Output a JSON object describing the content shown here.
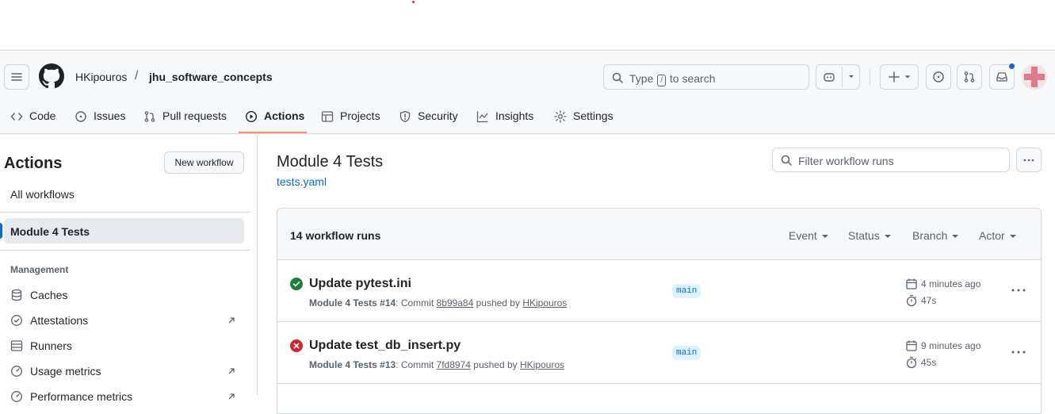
{
  "header": {
    "owner": "HKipouros",
    "separator": "/",
    "repo": "jhu_software_concepts",
    "search_prefix": "Type",
    "search_key": "/",
    "search_suffix": "to search"
  },
  "tabs": [
    {
      "label": "Code",
      "icon": "code-icon"
    },
    {
      "label": "Issues",
      "icon": "issue-icon"
    },
    {
      "label": "Pull requests",
      "icon": "pull-request-icon"
    },
    {
      "label": "Actions",
      "icon": "play-icon",
      "selected": true
    },
    {
      "label": "Projects",
      "icon": "table-icon"
    },
    {
      "label": "Security",
      "icon": "shield-icon"
    },
    {
      "label": "Insights",
      "icon": "graph-icon"
    },
    {
      "label": "Settings",
      "icon": "gear-icon"
    }
  ],
  "sidebar": {
    "title": "Actions",
    "new_workflow": "New workflow",
    "all_workflows": "All workflows",
    "active_workflow": "Module 4 Tests",
    "management_heading": "Management",
    "items": [
      {
        "label": "Caches",
        "icon": "database-icon",
        "external": false
      },
      {
        "label": "Attestations",
        "icon": "verified-icon",
        "external": true
      },
      {
        "label": "Runners",
        "icon": "server-icon",
        "external": false
      },
      {
        "label": "Usage metrics",
        "icon": "meter-icon",
        "external": true
      },
      {
        "label": "Performance metrics",
        "icon": "meter-icon",
        "external": true
      }
    ]
  },
  "main": {
    "title": "Module 4 Tests",
    "file": "tests.yaml",
    "filter_placeholder": "Filter workflow runs",
    "runs_count": "14 workflow runs",
    "filters": [
      "Event",
      "Status",
      "Branch",
      "Actor"
    ],
    "runs": [
      {
        "status": "success",
        "title": "Update pytest.ini",
        "workflow": "Module 4 Tests",
        "number": "#14",
        "commit_label": "Commit",
        "commit": "8b99a84",
        "pushed_by": "pushed by",
        "author": "HKipouros",
        "branch": "main",
        "time": "4 minutes ago",
        "duration": "47s"
      },
      {
        "status": "failure",
        "title": "Update test_db_insert.py",
        "workflow": "Module 4 Tests",
        "number": "#13",
        "commit_label": "Commit",
        "commit": "7fd8974",
        "pushed_by": "pushed by",
        "author": "HKipouros",
        "branch": "main",
        "time": "9 minutes ago",
        "duration": "45s"
      }
    ]
  },
  "colors": {
    "accent": "#0969da",
    "success": "#1a7f37",
    "failure": "#d1242f",
    "tab_underline": "#fd8c73"
  }
}
